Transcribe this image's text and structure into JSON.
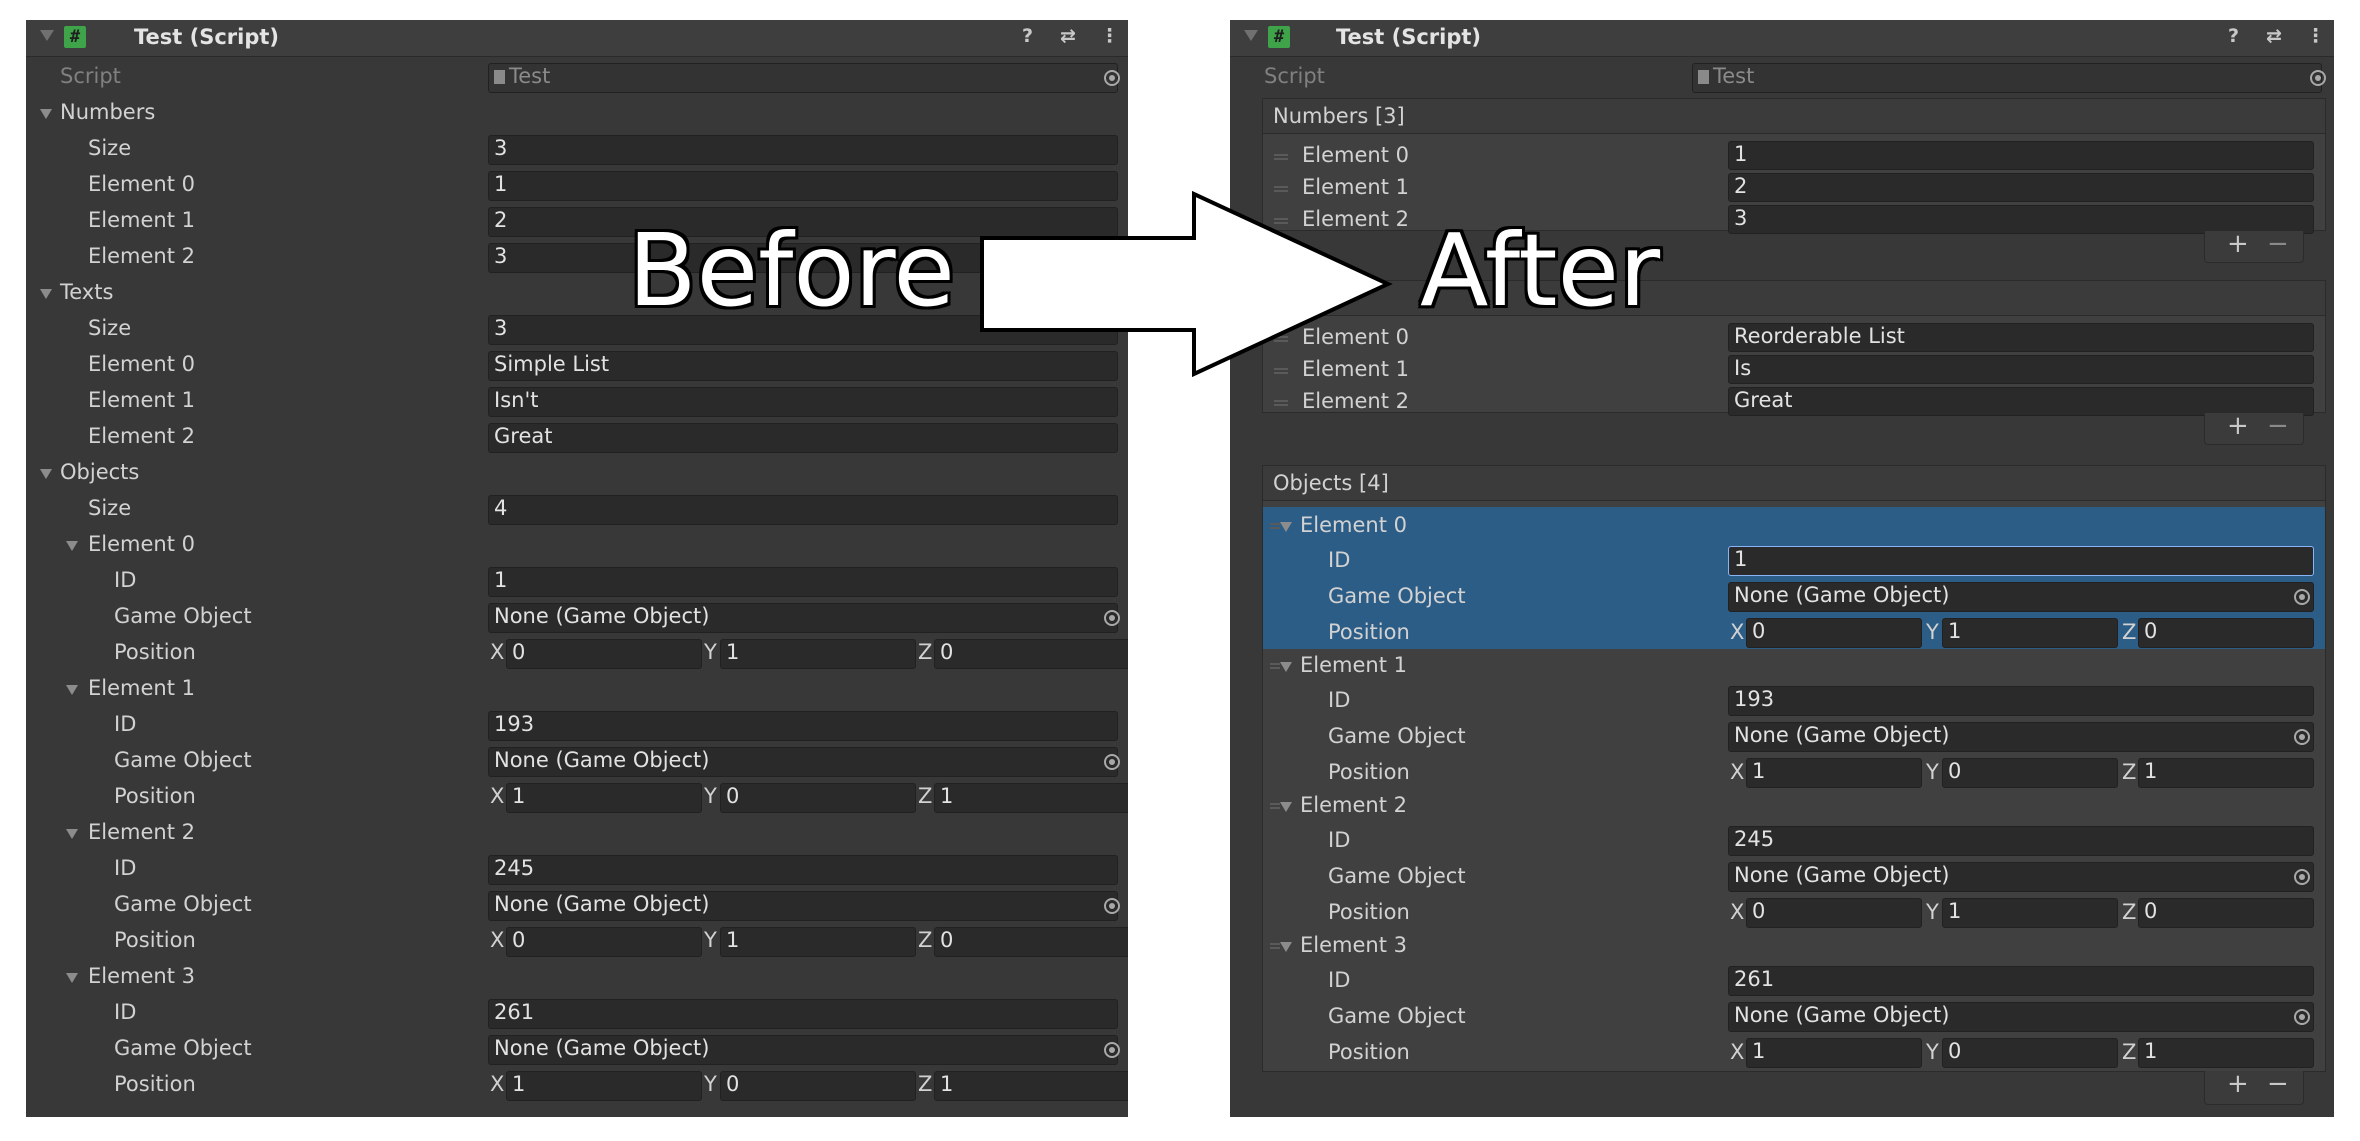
{
  "before": {
    "title": "Test (Script)",
    "script_label": "Script",
    "script_value": "Test",
    "numbers": {
      "label": "Numbers",
      "size_label": "Size",
      "size": "3",
      "elements": [
        {
          "label": "Element 0",
          "value": "1"
        },
        {
          "label": "Element 1",
          "value": "2"
        },
        {
          "label": "Element 2",
          "value": "3"
        }
      ]
    },
    "texts": {
      "label": "Texts",
      "size_label": "Size",
      "size": "3",
      "elements": [
        {
          "label": "Element 0",
          "value": "Simple List"
        },
        {
          "label": "Element 1",
          "value": "Isn't"
        },
        {
          "label": "Element 2",
          "value": "Great"
        }
      ]
    },
    "objects": {
      "label": "Objects",
      "size_label": "Size",
      "size": "4",
      "elements": [
        {
          "label": "Element 0",
          "id_label": "ID",
          "id": "1",
          "go_label": "Game Object",
          "go": "None (Game Object)",
          "pos_label": "Position",
          "x": "0",
          "y": "1",
          "z": "0"
        },
        {
          "label": "Element 1",
          "id_label": "ID",
          "id": "193",
          "go_label": "Game Object",
          "go": "None (Game Object)",
          "pos_label": "Position",
          "x": "1",
          "y": "0",
          "z": "1"
        },
        {
          "label": "Element 2",
          "id_label": "ID",
          "id": "245",
          "go_label": "Game Object",
          "go": "None (Game Object)",
          "pos_label": "Position",
          "x": "0",
          "y": "1",
          "z": "0"
        },
        {
          "label": "Element 3",
          "id_label": "ID",
          "id": "261",
          "go_label": "Game Object",
          "go": "None (Game Object)",
          "pos_label": "Position",
          "x": "1",
          "y": "0",
          "z": "1"
        }
      ]
    }
  },
  "after": {
    "title": "Test (Script)",
    "script_label": "Script",
    "script_value": "Test",
    "numbers": {
      "header": "Numbers [3]",
      "elements": [
        {
          "label": "Element 0",
          "value": "1"
        },
        {
          "label": "Element 1",
          "value": "2"
        },
        {
          "label": "Element 2",
          "value": "3"
        }
      ]
    },
    "texts": {
      "elements": [
        {
          "label": "Element 0",
          "value": "Reorderable List"
        },
        {
          "label": "Element 1",
          "value": "Is"
        },
        {
          "label": "Element 2",
          "value": "Great"
        }
      ]
    },
    "objects": {
      "header": "Objects [4]",
      "elements": [
        {
          "label": "Element 0",
          "id_label": "ID",
          "id": "1",
          "go_label": "Game Object",
          "go": "None (Game Object)",
          "pos_label": "Position",
          "x": "0",
          "y": "1",
          "z": "0"
        },
        {
          "label": "Element 1",
          "id_label": "ID",
          "id": "193",
          "go_label": "Game Object",
          "go": "None (Game Object)",
          "pos_label": "Position",
          "x": "1",
          "y": "0",
          "z": "1"
        },
        {
          "label": "Element 2",
          "id_label": "ID",
          "id": "245",
          "go_label": "Game Object",
          "go": "None (Game Object)",
          "pos_label": "Position",
          "x": "0",
          "y": "1",
          "z": "0"
        },
        {
          "label": "Element 3",
          "id_label": "ID",
          "id": "261",
          "go_label": "Game Object",
          "go": "None (Game Object)",
          "pos_label": "Position",
          "x": "1",
          "y": "0",
          "z": "1"
        }
      ]
    }
  },
  "axis_labels": {
    "x": "X",
    "y": "Y",
    "z": "Z"
  },
  "buttons": {
    "plus": "+",
    "minus": "−"
  },
  "overlay": {
    "before": "Before",
    "after": "After"
  },
  "icons": {
    "help": "help-icon",
    "preset": "preset-icon",
    "menu": "kebab-menu-icon",
    "hash": "#"
  },
  "colors": {
    "selection": "#2c5d87",
    "panel": "#383838",
    "field": "#2a2a2a"
  }
}
